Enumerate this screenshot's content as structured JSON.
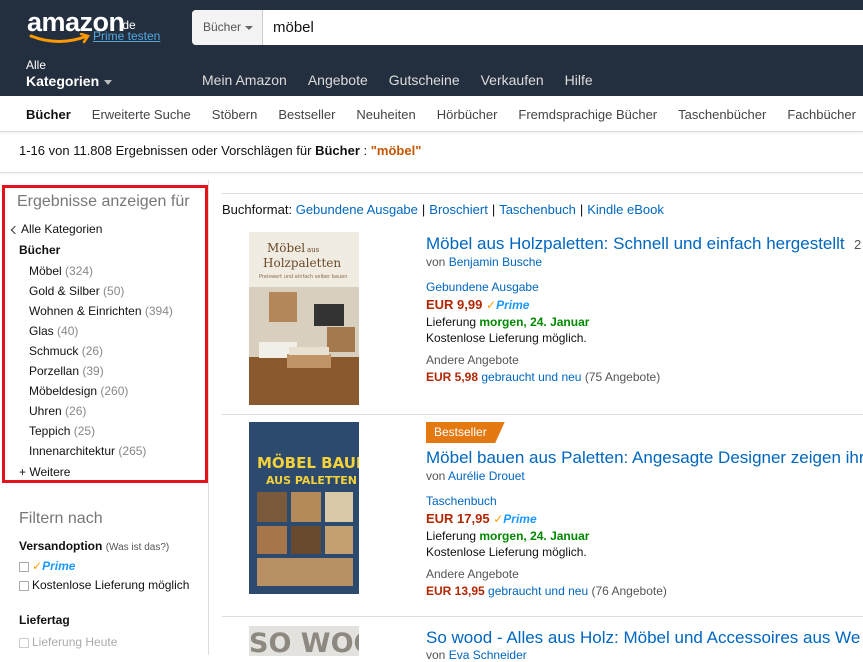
{
  "header": {
    "logo": {
      "word": "amazon",
      "tld": ".de",
      "prime_link": "Prime testen"
    },
    "search": {
      "category": "Bücher",
      "query": "möbel"
    },
    "category_menu": {
      "line1": "Alle",
      "line2": "Kategorien"
    },
    "nav_links": [
      "Mein Amazon",
      "Angebote",
      "Gutscheine",
      "Verkaufen",
      "Hilfe"
    ]
  },
  "subnav": {
    "items": [
      "Bücher",
      "Erweiterte Suche",
      "Stöbern",
      "Bestseller",
      "Neuheiten",
      "Hörbücher",
      "Fremdsprachige Bücher",
      "Taschenbücher",
      "Fachbücher",
      "S"
    ]
  },
  "results_bar": {
    "prefix": "1-16 von 11.808 Ergebnissen oder Vorschlägen für",
    "category": "Bücher",
    "colon": ":",
    "query": "\"möbel\""
  },
  "sidebar": {
    "refine_title": "Ergebnisse anzeigen für",
    "all_categories": "Alle Kategorien",
    "category_head": "Bücher",
    "categories": [
      {
        "label": "Möbel",
        "count": "(324)"
      },
      {
        "label": "Gold & Silber",
        "count": "(50)"
      },
      {
        "label": "Wohnen & Einrichten",
        "count": "(394)"
      },
      {
        "label": "Glas",
        "count": "(40)"
      },
      {
        "label": "Schmuck",
        "count": "(26)"
      },
      {
        "label": "Porzellan",
        "count": "(39)"
      },
      {
        "label": "Möbeldesign",
        "count": "(260)"
      },
      {
        "label": "Uhren",
        "count": "(26)"
      },
      {
        "label": "Teppich",
        "count": "(25)"
      },
      {
        "label": "Innenarchitektur",
        "count": "(265)"
      }
    ],
    "more": "+ Weitere",
    "filter_title": "Filtern nach",
    "shipping_head": "Versandoption",
    "shipping_hint": "(Was ist das?)",
    "prime_label": "Prime",
    "free_shipping": "Kostenlose Lieferung möglich",
    "delivery_head": "Liefertag",
    "delivery_today": "Lieferung Heute"
  },
  "main": {
    "format_label": "Buchformat:",
    "formats": [
      "Gebundene Ausgabe",
      "Broschiert",
      "Taschenbuch",
      "Kindle eBook"
    ],
    "results": [
      {
        "cover_title_1": "Möbel",
        "cover_title_2": "aus",
        "cover_title_3": "Holzpaletten",
        "cover_sub": "Preiswert und einfach selber bauen",
        "title": "Möbel aus Holzpaletten: Schnell und einfach hergestellt",
        "right_num": "2",
        "author_prefix": "von",
        "author": "Benjamin Busche",
        "format": "Gebundene Ausgabe",
        "price": "EUR 9,99",
        "prime": "Prime",
        "delivery_prefix": "Lieferung",
        "delivery_date": "morgen, 24. Januar",
        "free": "Kostenlose Lieferung möglich.",
        "other": "Andere Angebote",
        "used_price": "EUR 5,98",
        "used_link": "gebraucht und neu",
        "used_count": "(75 Angebote)"
      },
      {
        "badge": "Bestseller",
        "cover_title_1": "MÖBEL BAUEN",
        "cover_title_2": "AUS PALETTEN",
        "title": "Möbel bauen aus Paletten: Angesagte Designer zeigen ihre",
        "author_prefix": "von",
        "author": "Aurélie Drouet",
        "format": "Taschenbuch",
        "price": "EUR 17,95",
        "prime": "Prime",
        "delivery_prefix": "Lieferung",
        "delivery_date": "morgen, 24. Januar",
        "free": "Kostenlose Lieferung möglich.",
        "other": "Andere Angebote",
        "used_price": "EUR 13,95",
        "used_link": "gebraucht und neu",
        "used_count": "(76 Angebote)"
      },
      {
        "cover_title_1": "SO WOOD",
        "title": "So wood - Alles aus Holz: Möbel und Accessoires aus We",
        "author_prefix": "von",
        "author": "Eva Schneider"
      }
    ]
  },
  "colors": {
    "header_bg": "#232f3e",
    "link": "#0066c0",
    "price": "#b12704",
    "badge": "#e47911",
    "highlight_box": "#e3131c",
    "prime": "#1a98ff"
  }
}
